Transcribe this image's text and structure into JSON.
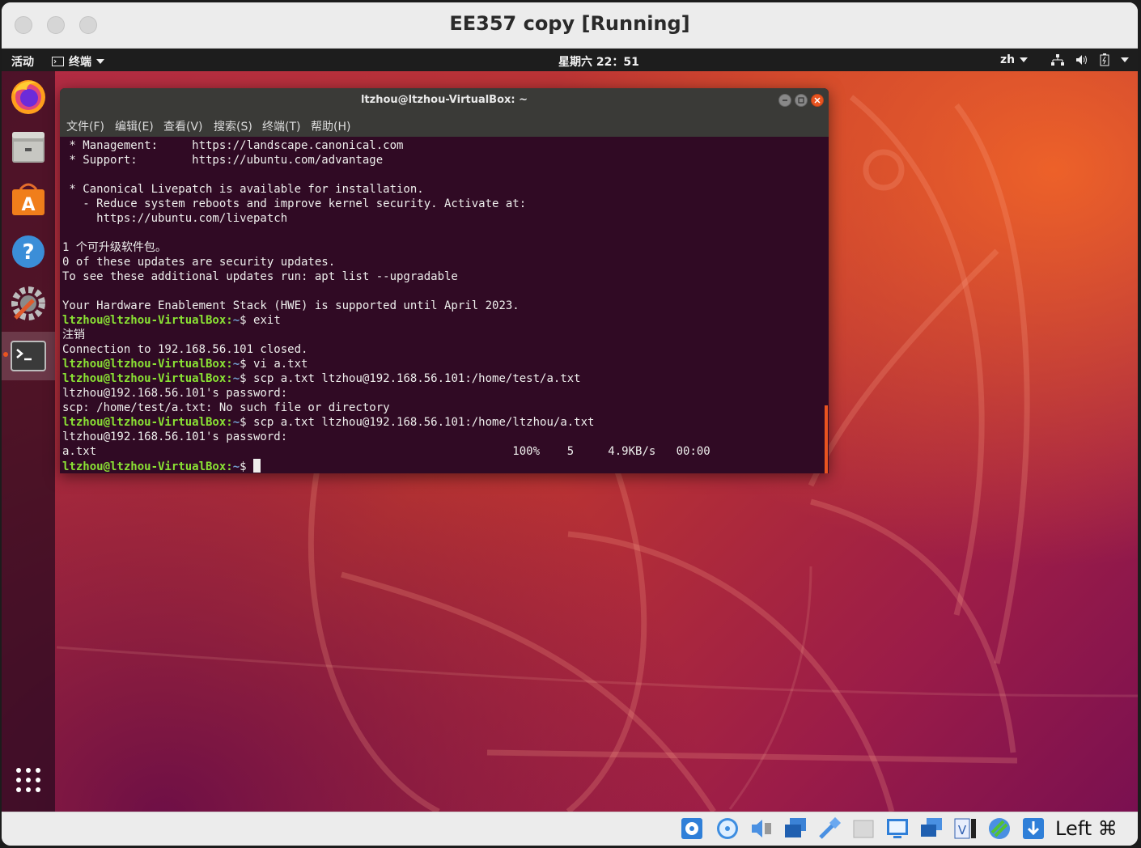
{
  "host_window": {
    "title": "EE357 copy [Running]"
  },
  "top_panel": {
    "activities": "活动",
    "app_menu": "终端",
    "clock": "星期六 22：51",
    "input_method": "zh"
  },
  "dock": {
    "items": [
      {
        "name": "Firefox"
      },
      {
        "name": "Files"
      },
      {
        "name": "Ubuntu Software"
      },
      {
        "name": "Help"
      },
      {
        "name": "Settings"
      },
      {
        "name": "Terminal",
        "active": true
      }
    ]
  },
  "terminal": {
    "title": "ltzhou@ltzhou-VirtualBox: ~",
    "menu": [
      "文件(F)",
      "编辑(E)",
      "查看(V)",
      "搜索(S)",
      "终端(T)",
      "帮助(H)"
    ],
    "lines": {
      "l1": " * Management:     https://landscape.canonical.com",
      "l2": " * Support:        https://ubuntu.com/advantage",
      "l3": " * Canonical Livepatch is available for installation.",
      "l4": "   - Reduce system reboots and improve kernel security. Activate at:",
      "l5": "     https://ubuntu.com/livepatch",
      "l6": "1 个可升级软件包。",
      "l7": "0 of these updates are security updates.",
      "l8": "To see these additional updates run: apt list --upgradable",
      "l9": "Your Hardware Enablement Stack (HWE) is supported until April 2023.",
      "l11": "注销",
      "l12": "Connection to 192.168.56.101 closed.",
      "l15": "ltzhou@192.168.56.101's password:",
      "l16": "scp: /home/test/a.txt: No such file or directory",
      "l18": "ltzhou@192.168.56.101's password:",
      "l19": "a.txt                                                             100%    5     4.9KB/s   00:00"
    },
    "prompt_user": "ltzhou@ltzhou-VirtualBox",
    "prompt_sep": ":",
    "prompt_path": "~",
    "commands": {
      "c10": "$ exit",
      "c13": "$ vi a.txt",
      "c14": "$ scp a.txt ltzhou@192.168.56.101:/home/test/a.txt",
      "c17": "$ scp a.txt ltzhou@192.168.56.101:/home/ltzhou/a.txt",
      "c20": "$ "
    }
  },
  "statusbar": {
    "host_key": "Left ⌘",
    "icons": [
      "hard-disk",
      "optical-drive",
      "audio",
      "network",
      "usb",
      "shared-folders",
      "display",
      "video-capture",
      "recording",
      "mouse-integration",
      "keyboard-capture"
    ]
  },
  "colors": {
    "terminal_bg": "#300a24",
    "prompt_user": "#8ae234",
    "prompt_path": "#729fcf",
    "ubuntu_orange": "#e95420"
  }
}
